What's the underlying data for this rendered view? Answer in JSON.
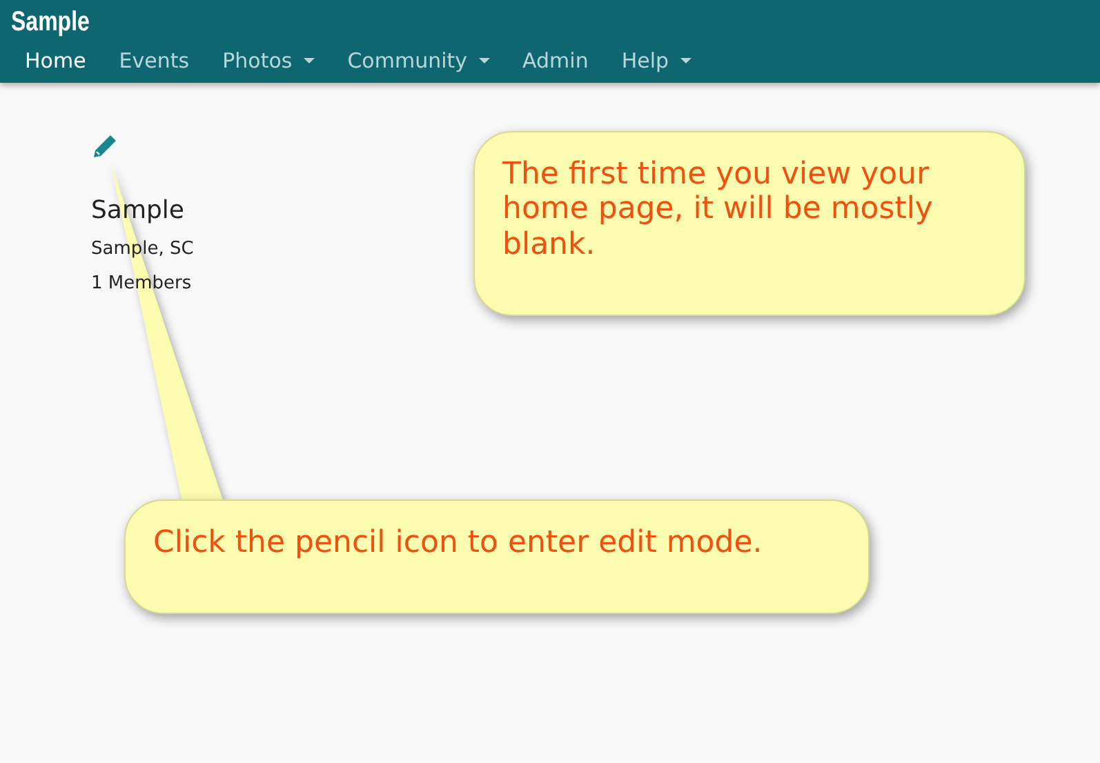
{
  "navbar": {
    "brand": "Sample",
    "items": [
      {
        "label": "Home",
        "selected": true,
        "dropdown": false
      },
      {
        "label": "Events",
        "selected": false,
        "dropdown": false
      },
      {
        "label": "Photos",
        "selected": false,
        "dropdown": true
      },
      {
        "label": "Community",
        "selected": false,
        "dropdown": true
      },
      {
        "label": "Admin",
        "selected": false,
        "dropdown": false
      },
      {
        "label": "Help",
        "selected": false,
        "dropdown": true
      }
    ]
  },
  "group": {
    "name": "Sample",
    "location": "Sample, SC",
    "members": "1 Members"
  },
  "callouts": [
    {
      "text": "The first time you view your home page, it will be mostly blank."
    },
    {
      "text": "Click the pencil icon to enter edit mode."
    }
  ]
}
